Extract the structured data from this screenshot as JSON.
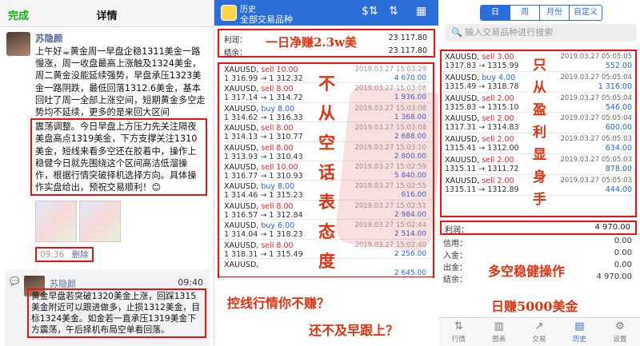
{
  "left": {
    "done_label": "完成",
    "title": "详情",
    "post": {
      "author": "苏隐颜",
      "text_normal": "上午好☕黄金周一早盘企稳1311美金一路慢涨，周一收盘最高上涨触及1324美金，周二黄金没能延续强势，早盘承压1323美金一路阴跌，最低回落1312.6美金，基本回吐了周一全部上涨空间，短期黄金多空走势均不延续，更多的是来回大区间",
      "text_highlight": "震荡调整。今日早盘上方压力先关注隔夜美盘高点1319美金，下方支撑关注1310美金，短线来看多空还在胶着中，操作上稳健今日就先围绕这个区间高洁低溜操作，根据行情突破择机选择方向。具体操作实盘给出，预祝交易顺利！😊",
      "time": "09:36",
      "delete_label": "删除"
    },
    "comment": {
      "author": "苏隐颜",
      "time": "09:40",
      "text": "黄金早盘若突破1320美金上涨，回踩1315美金附近可以跟进做多，止损1312美金，目标1324美金。如金若一直承压1319美金下方震荡，午后择机布局空单看回落。"
    }
  },
  "middle": {
    "header_small": "历史",
    "header_title": "全部交易品种",
    "summary": {
      "profit_label": "利润：",
      "profit_value": "23 117.80",
      "balance_label": "结余：",
      "balance_value": "23 117.80"
    },
    "slogan_top": "一日净赚2.3w美",
    "slogan_vertical": "不从空话表态度",
    "trades": [
      {
        "symbol": "XAUUSD,",
        "side": "sell 10.00",
        "type": "sell",
        "prices": "1 316.99 → 1 312.32",
        "date": "2019.03.27 15:03:29",
        "profit": "4 670.00"
      },
      {
        "symbol": "XAUUSD,",
        "side": "sell 8.00",
        "type": "sell",
        "prices": "1 317.14 → 1 314.72",
        "date": "2019.03.27 15:03:08",
        "profit": "1 936.00"
      },
      {
        "symbol": "XAUUSD,",
        "side": "buy 8.00",
        "type": "buy",
        "prices": "1 314.62 → 1 316.33",
        "date": "2019.03.27 15:03:08",
        "profit": "1 368.00"
      },
      {
        "symbol": "XAUUSD,",
        "side": "sell 8.00",
        "type": "sell",
        "prices": "1 314.13 → 1 310.77",
        "date": "2019.03.27 15:03:08",
        "profit": "2 688.00"
      },
      {
        "symbol": "XAUUSD,",
        "side": "sell 8.00",
        "type": "sell",
        "prices": "1 313.93 → 1 310.43",
        "date": "2019.03.27 15:03:10",
        "profit": "2 800.00"
      },
      {
        "symbol": "XAUUSD,",
        "side": "sell 10.00",
        "type": "sell",
        "prices": "1 316.77 → 1 310.93",
        "date": "2019.03.27 15:02:59",
        "profit": "5 840.00"
      },
      {
        "symbol": "XAUUSD,",
        "side": "buy 8.00",
        "type": "buy",
        "prices": "1 314.46 → 1 315.23",
        "date": "2019.03.27 15:02:55",
        "profit": "616.00"
      },
      {
        "symbol": "XAUUSD,",
        "side": "sell 8.00",
        "type": "sell",
        "prices": "1 316.57 → 1 312.84",
        "date": "2019.03.27 15:02:51",
        "profit": "2 984.00"
      },
      {
        "symbol": "XAUUSD,",
        "side": "buy 6.00",
        "type": "buy",
        "prices": "1 314.04 → 1 318.23",
        "date": "2019.03.27 15:02:44",
        "profit": "2 514.00"
      },
      {
        "symbol": "XAUUSD,",
        "side": "sell 8.00",
        "type": "sell",
        "prices": "1 318.31 → 1 315.49",
        "date": "2019.03.27 15:02:40",
        "profit": "2 256.00"
      },
      {
        "symbol": "XAUUSD,",
        "side": "",
        "type": "sell",
        "prices": "",
        "date": "",
        "profit": "2 645.00"
      }
    ],
    "caption1": "控线行情你不赚？",
    "caption2": "还不及早跟上？"
  },
  "right": {
    "segments": [
      "日",
      "周",
      "月份",
      "自定义"
    ],
    "active_segment": "日",
    "search_placeholder": "输入交易品种进行搜索",
    "slogan_vertical": "只从盈利显身手",
    "trades": [
      {
        "symbol": "XAUUSD,",
        "side": "sell 3.00",
        "type": "sell",
        "prices": "1317.83 → 1315.99",
        "date": "2019.03.27 05:05:05",
        "profit": "552.00"
      },
      {
        "symbol": "XAUUSD,",
        "side": "buy 4.00",
        "type": "buy",
        "prices": "1315.49 → 1318.78",
        "date": "2019.03.27 05:05:04",
        "profit": "1 316.00"
      },
      {
        "symbol": "XAUUSD,",
        "side": "sell 2.00",
        "type": "sell",
        "prices": "1315.83 → 1315.10",
        "date": "2019.03.27 05:05:04",
        "profit": "546.00"
      },
      {
        "symbol": "XAUUSD,",
        "side": "sell 2.00",
        "type": "sell",
        "prices": "1317.31 → 1314.83",
        "date": "2019.03.27 05:05:04",
        "profit": "600.00"
      },
      {
        "symbol": "XAUUSD,",
        "side": "sell 2.00",
        "type": "sell",
        "prices": "1315.41 → 1312.00",
        "date": "2019.03.27 05:05:03",
        "profit": "634.00"
      },
      {
        "symbol": "XAUUSD,",
        "side": "sell 2.00",
        "type": "sell",
        "prices": "1315.11 → 1311.72",
        "date": "2019.03.27 05:05:03",
        "profit": "878.00"
      },
      {
        "symbol": "XAUUSD,",
        "side": "sell 2.00",
        "type": "sell",
        "prices": "1315.11 → 1312.89",
        "date": "2019.03.27 05:05:03",
        "profit": "444.00"
      }
    ],
    "profit_label": "利润：",
    "profit_value": "4 970.00",
    "stats": [
      {
        "label": "信用：",
        "value": "0.00"
      },
      {
        "label": "入金：",
        "value": "0.00"
      },
      {
        "label": "出金：",
        "value": "0.00"
      },
      {
        "label": "结余：",
        "value": "4 970.00"
      }
    ],
    "caption1": "多空稳健操作",
    "caption2": "日赚5000美金",
    "tabs": [
      {
        "label": "行情",
        "icon": "quotes-icon",
        "glyph": "⇅"
      },
      {
        "label": "图表",
        "icon": "chart-icon",
        "glyph": "▥"
      },
      {
        "label": "交易",
        "icon": "trade-icon",
        "glyph": "↗"
      },
      {
        "label": "历史",
        "icon": "history-icon",
        "glyph": "▤"
      },
      {
        "label": "设置",
        "icon": "settings-icon",
        "glyph": "⚙"
      }
    ],
    "active_tab": "历史"
  },
  "colors": {
    "sell": "#e02828",
    "buy": "#2266d8",
    "accent": "#2b6ed8",
    "highlight_border": "#e11"
  }
}
